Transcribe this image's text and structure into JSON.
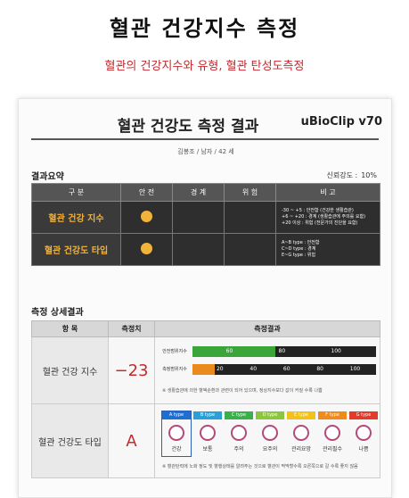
{
  "page": {
    "title": "혈관 건강지수 측정",
    "subtitle": "혈관의 건강지수와 유형, 혈관 탄성도측정"
  },
  "report": {
    "title": "혈관 건강도 측정 결과",
    "brand": "uBioClip v70",
    "person": "김봉조 / 남자 / 42 세",
    "summary_label": "결과요약",
    "reliability_label": "신뢰강도 :",
    "reliability_value": "10%",
    "summary_headers": [
      "구 분",
      "안 전",
      "경 계",
      "위 험",
      "비 고"
    ],
    "summary_rows": [
      {
        "label": "혈관 건강 지수",
        "note": [
          "-30 ~ +5  : 안전함 (건강한 생활습관)",
          "+6 ~ +20 : 경계 (생활습관에 주의를 요함)",
          "+20 이상 : 위험 (전문가의 진단을 요함)"
        ]
      },
      {
        "label": "혈관 건강도 타입",
        "note": [
          "A~B type  : 안전함",
          "C~D type  : 경계",
          "E~G type  : 위험"
        ]
      }
    ],
    "detail_label": "측정 상세결과",
    "detail_headers": [
      "항 목",
      "측정치",
      "측정결과"
    ],
    "index_label": "혈관 건강 지수",
    "index_value": "−23",
    "type_label": "혈관 건강도 타입",
    "type_value": "A",
    "bars": [
      {
        "label": "안전범위지수",
        "segments": [
          {
            "color": "#3aa63a",
            "fraction": 0.45
          }
        ],
        "ticks": [
          "60",
          "80",
          "100"
        ]
      },
      {
        "label": "측정범위지수",
        "segments": [
          {
            "color": "#e98a1c",
            "fraction": 0.12
          }
        ],
        "ticks": [
          "20",
          "40",
          "60",
          "80",
          "100"
        ]
      }
    ],
    "bar_note": "※ 생활습관에 의한 혈액순환과 관련이 되어 있으며, 정상지수보다 값이 커질 수록 나쁨",
    "types": [
      {
        "cap": "A type",
        "name": "건강",
        "color": "#1f6fd1",
        "selected": true
      },
      {
        "cap": "B type",
        "name": "보통",
        "color": "#2aa0d8",
        "selected": false
      },
      {
        "cap": "C type",
        "name": "주의",
        "color": "#3ab04a",
        "selected": false
      },
      {
        "cap": "D type",
        "name": "요주의",
        "color": "#8cc63e",
        "selected": false
      },
      {
        "cap": "E type",
        "name": "관리요망",
        "color": "#f2c11a",
        "selected": false
      },
      {
        "cap": "F type",
        "name": "관리필수",
        "color": "#f08a1a",
        "selected": false
      },
      {
        "cap": "G type",
        "name": "나쁨",
        "color": "#e33b2a",
        "selected": false
      }
    ],
    "type_note": "※ 혈관탄력에 노화 정도 및 혈행상태를 알려주는 것으로 혈관이 딱딱할수록 오른쪽으로 갈 수록 좋지 않음"
  }
}
